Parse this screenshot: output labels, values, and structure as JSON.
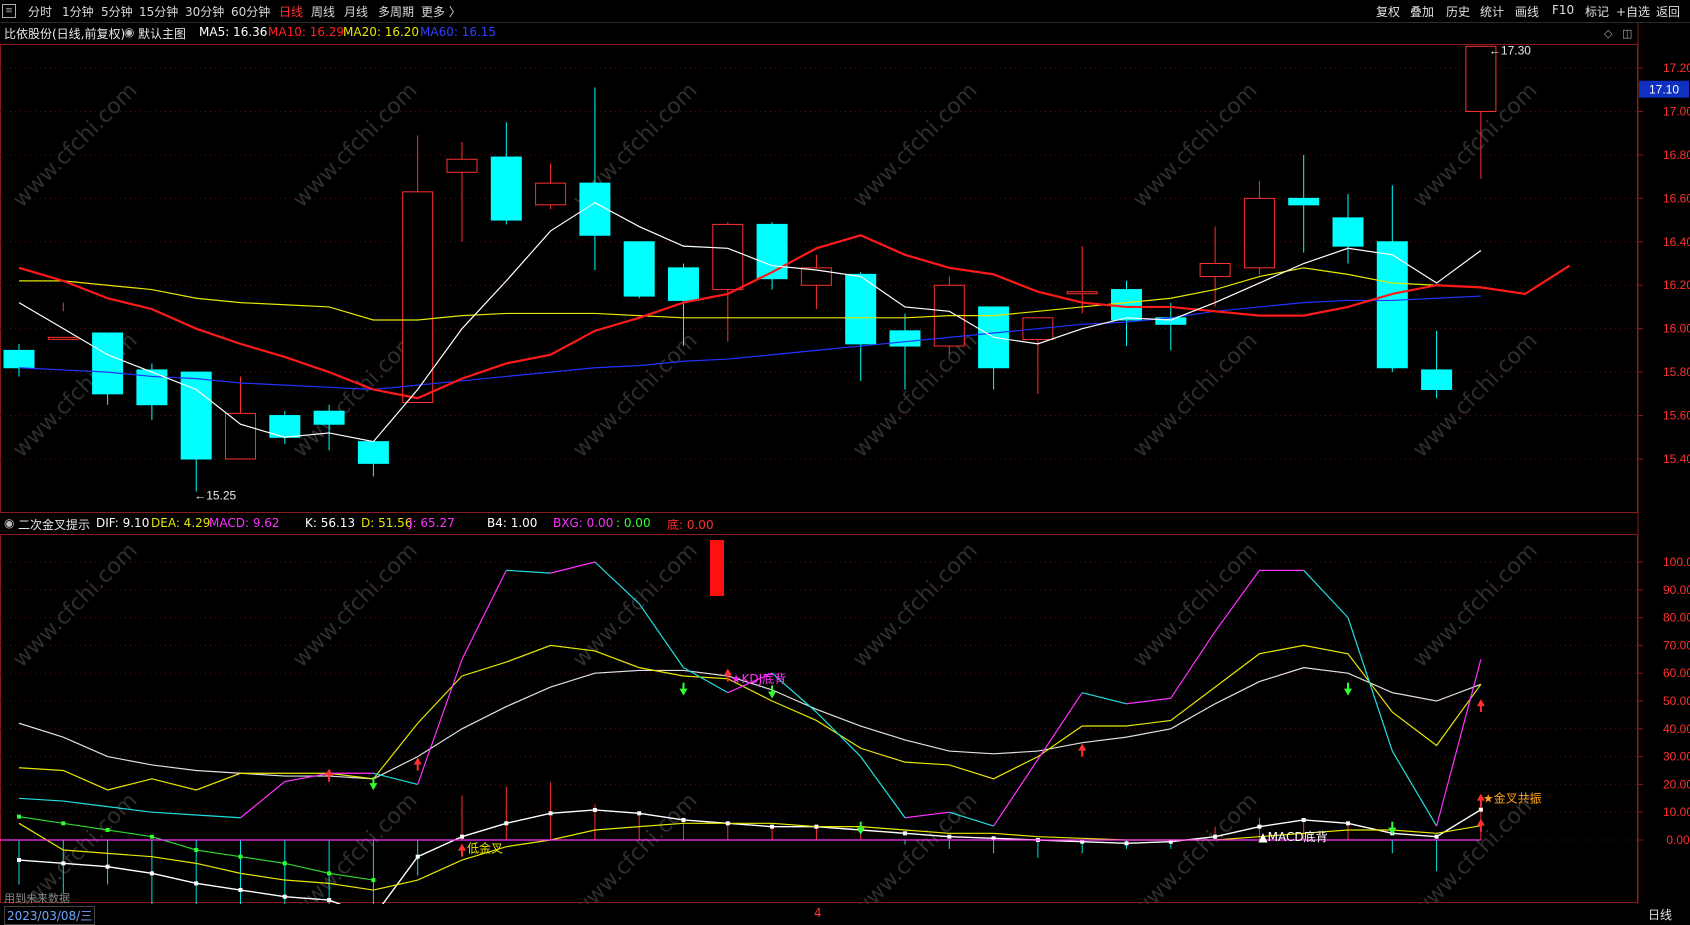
{
  "toolbar": {
    "periods": [
      {
        "label": "分时",
        "x": 28
      },
      {
        "label": "1分钟",
        "x": 62
      },
      {
        "label": "5分钟",
        "x": 101
      },
      {
        "label": "15分钟",
        "x": 139
      },
      {
        "label": "30分钟",
        "x": 185
      },
      {
        "label": "60分钟",
        "x": 231
      },
      {
        "label": "日线",
        "x": 279,
        "active": true
      },
      {
        "label": "周线",
        "x": 311
      },
      {
        "label": "月线",
        "x": 344
      },
      {
        "label": "多周期",
        "x": 378
      },
      {
        "label": "更多 〉",
        "x": 421
      }
    ],
    "right": [
      {
        "label": "复权",
        "x": 1376
      },
      {
        "label": "叠加",
        "x": 1410
      },
      {
        "label": "历史",
        "x": 1446
      },
      {
        "label": "统计",
        "x": 1480
      },
      {
        "label": "画线",
        "x": 1515
      },
      {
        "label": "F10",
        "x": 1552
      },
      {
        "label": "标记",
        "x": 1585
      },
      {
        "label": "+自选",
        "x": 1616
      },
      {
        "label": "返回",
        "x": 1656
      }
    ]
  },
  "main_chart": {
    "title": "比依股份(日线,前复权)",
    "mode": "默认主图",
    "ma5": "MA5: 16.36",
    "ma10": "MA10: 16.29",
    "ma20": "MA20: 16.20",
    "ma60": "MA60: 16.15",
    "ma5_color": "#ffffff",
    "ma10_color": "#ff1a1a",
    "ma20_color": "#e6e600",
    "ma60_color": "#2233ff",
    "high_label": "17.30",
    "low_label": "15.25",
    "price_tag": "17.10",
    "y_ticks": [
      "17.20",
      "17.00",
      "16.80",
      "16.60",
      "16.40",
      "16.20",
      "16.00",
      "15.80",
      "15.60",
      "15.40"
    ]
  },
  "sub_chart": {
    "title": "二次金叉提示",
    "dif": "DIF: 9.10",
    "dea": "DEA: 4.29",
    "macd": "MACD: 9.62",
    "k": "K: 56.13",
    "d": "D: 51.56",
    "j": "J: 65.27",
    "b4": "B4: 1.00",
    "bxg": "BXG: 0.00",
    "colon": ": 0.00",
    "di": "底: 0.00",
    "y_ticks": [
      "100.0",
      "90.00",
      "80.00",
      "70.00",
      "60.00",
      "50.00",
      "40.00",
      "30.00",
      "20.00",
      "10.00",
      "0.00"
    ],
    "annotations": [
      "低金叉",
      "KDJ底背",
      "MACD底背",
      "金叉共振"
    ]
  },
  "bottom": {
    "date": "2023/03/08/三",
    "marker": "4",
    "period": "日线",
    "note": "用到未来数据"
  },
  "watermark": "www.cfchi.com",
  "chart_data": {
    "type": "candlestick",
    "ohlc": [
      [
        15.9,
        15.93,
        15.82,
        15.78
      ],
      [
        15.96,
        16.12,
        15.96,
        16.08
      ],
      [
        15.98,
        15.98,
        15.7,
        15.65
      ],
      [
        15.81,
        15.84,
        15.65,
        15.58
      ],
      [
        15.8,
        15.8,
        15.4,
        15.25
      ],
      [
        15.4,
        15.78,
        15.61,
        15.4
      ],
      [
        15.6,
        15.62,
        15.5,
        15.47
      ],
      [
        15.62,
        15.65,
        15.56,
        15.44
      ],
      [
        15.48,
        15.48,
        15.38,
        15.32
      ],
      [
        15.66,
        16.89,
        16.63,
        15.66
      ],
      [
        16.72,
        16.86,
        16.78,
        16.4
      ],
      [
        16.79,
        16.95,
        16.5,
        16.48
      ],
      [
        16.57,
        16.76,
        16.67,
        16.55
      ],
      [
        16.67,
        17.11,
        16.43,
        16.27
      ],
      [
        16.4,
        16.4,
        16.15,
        16.14
      ],
      [
        16.28,
        16.3,
        16.13,
        15.92
      ],
      [
        16.18,
        16.49,
        16.48,
        15.94
      ],
      [
        16.48,
        16.49,
        16.23,
        16.18
      ],
      [
        16.2,
        16.34,
        16.28,
        16.09
      ],
      [
        16.25,
        16.26,
        15.93,
        15.76
      ],
      [
        15.99,
        16.07,
        15.92,
        15.72
      ],
      [
        15.92,
        16.24,
        16.2,
        15.88
      ],
      [
        16.1,
        16.1,
        15.82,
        15.72
      ],
      [
        15.95,
        16.04,
        16.05,
        15.7
      ],
      [
        16.17,
        16.38,
        16.17,
        16.07
      ],
      [
        16.18,
        16.22,
        16.04,
        15.92
      ],
      [
        16.05,
        16.12,
        16.02,
        15.9
      ],
      [
        16.24,
        16.47,
        16.3,
        16.1
      ],
      [
        16.28,
        16.68,
        16.6,
        16.25
      ],
      [
        16.6,
        16.8,
        16.57,
        16.35
      ],
      [
        16.51,
        16.62,
        16.38,
        16.3
      ],
      [
        16.4,
        16.66,
        15.82,
        15.8
      ],
      [
        15.81,
        15.99,
        15.72,
        15.68
      ],
      [
        17.0,
        17.3,
        17.3,
        16.69
      ]
    ],
    "ma5": [
      16.12,
      16.0,
      15.88,
      15.8,
      15.72,
      15.56,
      15.5,
      15.52,
      15.48,
      15.72,
      16.0,
      16.22,
      16.45,
      16.58,
      16.47,
      16.38,
      16.37,
      16.29,
      16.27,
      16.24,
      16.1,
      16.08,
      15.96,
      15.93,
      16.0,
      16.05,
      16.04,
      16.12,
      16.21,
      16.3,
      16.37,
      16.34,
      16.21,
      16.36
    ],
    "ma10": [
      16.28,
      16.22,
      16.14,
      16.09,
      16.0,
      15.93,
      15.87,
      15.8,
      15.72,
      15.68,
      15.77,
      15.84,
      15.88,
      15.99,
      16.05,
      16.12,
      16.16,
      16.26,
      16.37,
      16.43,
      16.34,
      16.28,
      16.25,
      16.17,
      16.12,
      16.1,
      16.1,
      16.08,
      16.06,
      16.06,
      16.1,
      16.16,
      16.2,
      16.19,
      16.16,
      16.29
    ],
    "ma20": [
      16.22,
      16.22,
      16.2,
      16.18,
      16.14,
      16.12,
      16.11,
      16.1,
      16.04,
      16.04,
      16.06,
      16.07,
      16.07,
      16.07,
      16.06,
      16.05,
      16.05,
      16.05,
      16.05,
      16.05,
      16.05,
      16.06,
      16.06,
      16.08,
      16.1,
      16.12,
      16.14,
      16.18,
      16.24,
      16.28,
      16.25,
      16.21,
      16.2
    ],
    "ma60": [
      15.82,
      15.81,
      15.8,
      15.78,
      15.77,
      15.75,
      15.74,
      15.73,
      15.72,
      15.74,
      15.76,
      15.78,
      15.8,
      15.82,
      15.83,
      15.85,
      15.86,
      15.88,
      15.9,
      15.92,
      15.94,
      15.96,
      15.98,
      16.0,
      16.02,
      16.03,
      16.05,
      16.08,
      16.1,
      16.12,
      16.13,
      16.13,
      16.14,
      16.15
    ],
    "kdj": {
      "K": [
        42,
        37,
        30,
        27,
        25,
        24,
        23,
        23,
        22,
        30,
        40,
        48,
        55,
        60,
        61,
        61,
        59,
        54,
        47,
        41,
        36,
        32,
        31,
        32,
        35,
        37,
        40,
        49,
        57,
        62,
        60,
        53,
        50,
        56
      ],
      "D": [
        26,
        25,
        18,
        22,
        18,
        24,
        24,
        24,
        22,
        42,
        59,
        64,
        70,
        68,
        62,
        59,
        58,
        50,
        43,
        33,
        28,
        27,
        22,
        30,
        41,
        41,
        43,
        55,
        67,
        70,
        67,
        46,
        34,
        56
      ],
      "J": [
        15,
        14,
        12,
        10,
        9,
        8,
        21,
        24,
        24,
        20,
        65,
        97,
        96,
        100,
        85,
        62,
        53,
        60,
        46,
        30,
        8,
        10,
        5,
        29,
        53,
        49,
        51,
        75,
        97,
        97,
        80,
        32,
        5,
        65
      ]
    },
    "macd": {
      "DIF": [
        -6,
        -7,
        -8,
        -10,
        -13,
        -15,
        -17,
        -18,
        -23,
        -5,
        1,
        5,
        8,
        9,
        8,
        6,
        5,
        4,
        4,
        3,
        2,
        1,
        0.5,
        0,
        -0.5,
        -1,
        -0.5,
        1,
        4,
        6,
        5,
        2,
        1,
        9.1
      ],
      "DEA": [
        5,
        -3,
        -4,
        -5,
        -7,
        -10,
        -12,
        -13,
        -15,
        -12,
        -6,
        -2,
        0,
        3,
        4,
        5,
        5,
        5,
        4,
        4,
        3,
        2,
        2,
        1,
        0.5,
        0,
        0,
        0,
        1,
        2,
        3,
        3,
        2,
        4.29
      ],
      "HIST": [
        -10,
        -12,
        -10,
        -15,
        -20,
        -22,
        -24,
        -26,
        -28,
        -8,
        10,
        12,
        13,
        8,
        6,
        5,
        4,
        3,
        3,
        2,
        -1,
        -2,
        -3,
        -4,
        -3,
        -2,
        -2,
        3,
        5,
        5,
        4,
        -3,
        -7,
        9.62
      ]
    },
    "y_range_main": [
      15.25,
      17.3
    ],
    "y_range_sub": [
      -30,
      100
    ]
  }
}
